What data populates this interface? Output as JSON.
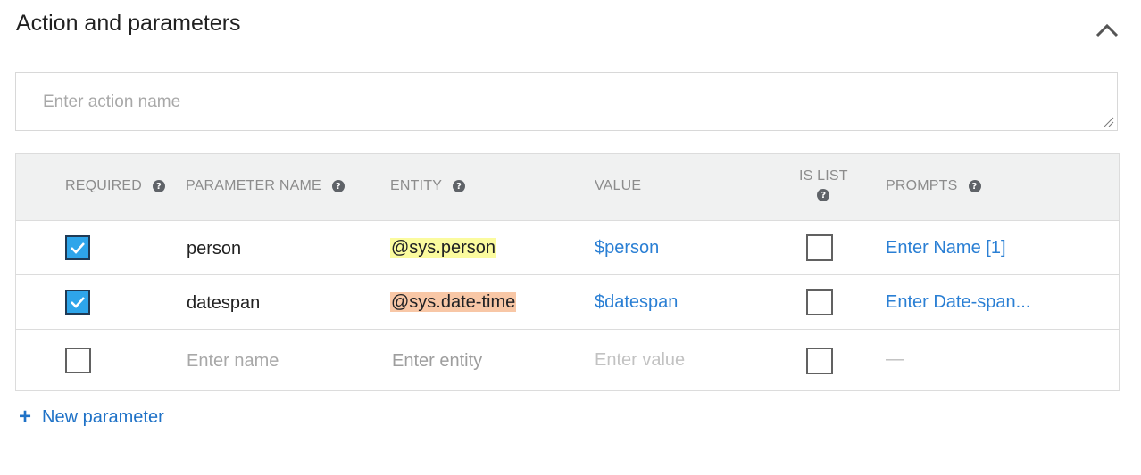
{
  "section": {
    "title": "Action and parameters",
    "action_placeholder": "Enter action name"
  },
  "table": {
    "headers": {
      "required": "REQUIRED",
      "parameter_name": "PARAMETER NAME",
      "entity": "ENTITY",
      "value": "VALUE",
      "is_list": "IS LIST",
      "prompts": "PROMPTS"
    },
    "rows": [
      {
        "required": true,
        "name": "person",
        "entity": "@sys.person",
        "value": "$person",
        "is_list": false,
        "prompts": "Enter Name [1]"
      },
      {
        "required": true,
        "name": "datespan",
        "entity": "@sys.date-time",
        "value": "$datespan",
        "is_list": false,
        "prompts": "Enter Date-span..."
      }
    ],
    "new_row": {
      "name_placeholder": "Enter name",
      "entity_placeholder": "Enter entity",
      "value_placeholder": "Enter value",
      "prompts_placeholder": "—"
    }
  },
  "new_parameter_label": "New parameter",
  "colors": {
    "checkbox_checked": "#2ea5ea",
    "link": "#2a7fd4",
    "entity_person_highlight": "#fbfb9e",
    "entity_datetime_highlight": "#f8c7a6"
  }
}
